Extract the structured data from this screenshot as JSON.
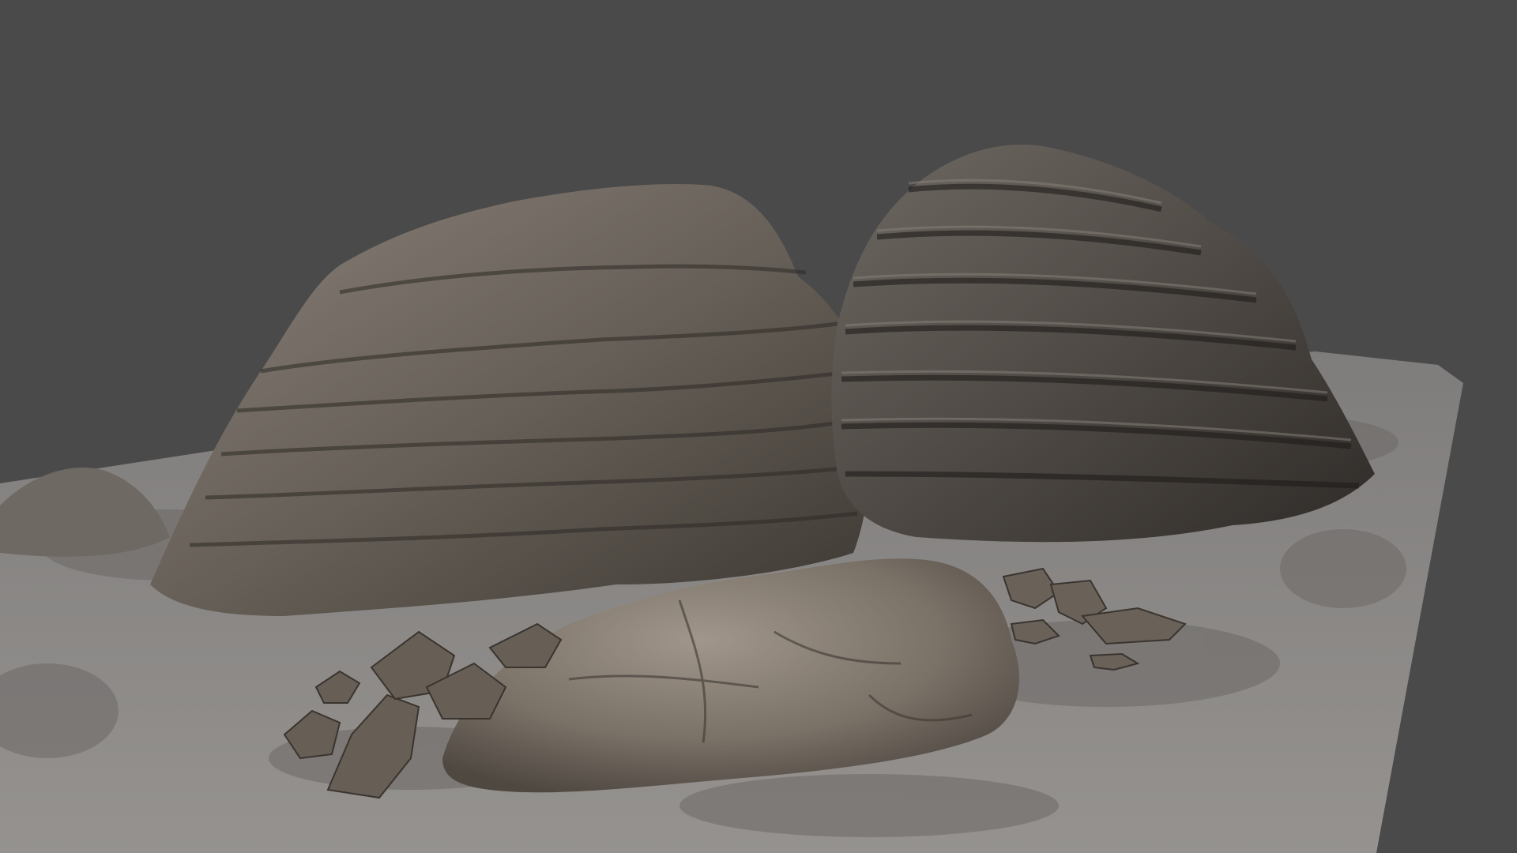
{
  "viewport": {
    "background_color": "#4a4a4a"
  },
  "scene": {
    "ground_color": "#8a8887",
    "ground_stain_color": "#6e6a68",
    "left_rock_color": "#6a645f",
    "left_rock_shadow_color": "#3e3935",
    "right_rock_color": "#56504b",
    "right_rock_shadow_color": "#2e2a27",
    "boulder_color": "#7a7167",
    "boulder_highlight_color": "#9a8f84",
    "debris_color": "#6b6259"
  }
}
